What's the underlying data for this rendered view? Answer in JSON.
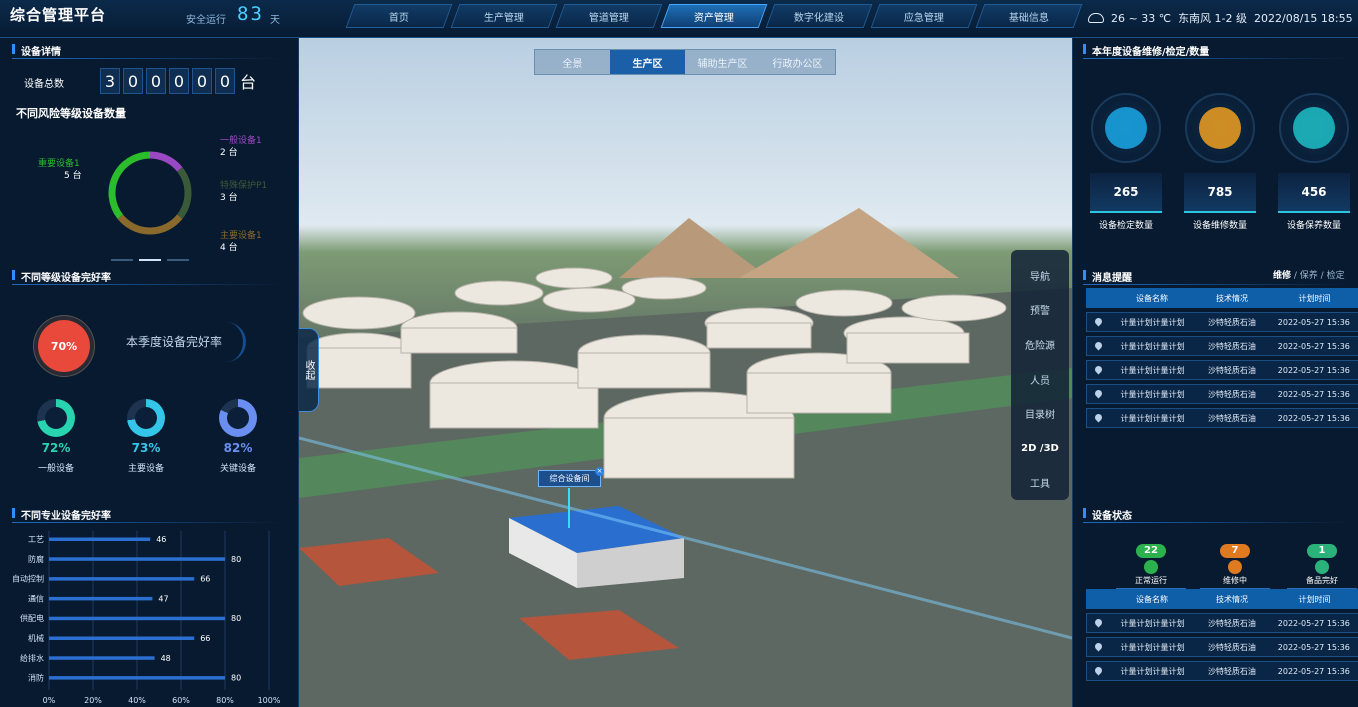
{
  "header": {
    "brand": "综合管理平台",
    "safe_label": "安全运行",
    "safe_days": "83",
    "days_unit": "天",
    "nav": [
      "首页",
      "生产管理",
      "管道管理",
      "资产管理",
      "数字化建设",
      "应急管理",
      "基础信息"
    ],
    "active_nav": "资产管理",
    "weather": {
      "temp": "26 ~ 33 ℃",
      "wind": "东南风 1-2 级",
      "datetime": "2022/08/15 18:55"
    }
  },
  "left": {
    "section1_title": "设备详情",
    "total_label": "设备总数",
    "total_digits": [
      "3",
      "0",
      "0",
      "0",
      "0",
      "0"
    ],
    "total_unit": "台",
    "risk_title": "不同风险等级设备数量",
    "risk_items": [
      {
        "name": "一般设备1",
        "count": "2 台",
        "value": 2,
        "color": "#9b49c2"
      },
      {
        "name": "特殊保护P1",
        "count": "3 台",
        "value": 3,
        "color": "#3b5a3a"
      },
      {
        "name": "主要设备1",
        "count": "4 台",
        "value": 4,
        "color": "#8a6a2c"
      },
      {
        "name": "重要设备1",
        "count": "5 台",
        "value": 5,
        "color": "#2bbd2b"
      }
    ],
    "section2_title": "不同等级设备完好率",
    "quarter_rate": "70%",
    "quarter_label": "本季度设备完好率",
    "rates": [
      {
        "value": "72%",
        "pct": 72,
        "label": "一般设备",
        "color": "#28d3b0"
      },
      {
        "value": "73%",
        "pct": 73,
        "label": "主要设备",
        "color": "#34c6e8"
      },
      {
        "value": "82%",
        "pct": 82,
        "label": "关键设备",
        "color": "#6b8ff0"
      }
    ],
    "section3_title": "不同专业设备完好率"
  },
  "chart_data": {
    "type": "bar",
    "title": "不同专业设备完好率",
    "categories": [
      "工艺",
      "防腐",
      "自动控制",
      "通信",
      "供配电",
      "机械",
      "给排水",
      "消防"
    ],
    "values": [
      46,
      80,
      66,
      47,
      80,
      66,
      48,
      80
    ],
    "xlim": [
      0,
      100
    ],
    "xticks": [
      "0%",
      "20%",
      "40%",
      "60%",
      "80%",
      "100%"
    ],
    "grid": true
  },
  "scene": {
    "zone_tabs": [
      "全景",
      "生产区",
      "辅助生产区",
      "行政办公区"
    ],
    "active_zone": "生产区",
    "collapse_label": "收起",
    "tools": [
      "导航",
      "预警",
      "危险源",
      "人员",
      "目录树",
      "2D /3D",
      "工具"
    ],
    "tag_label": "综合设备间",
    "tag_close": "×"
  },
  "right": {
    "section1_title": "本年度设备维修/检定/数量",
    "stats": [
      {
        "value": "265",
        "label": "设备检定数量",
        "icon": "shield-search-icon",
        "color": "#1aa8e8"
      },
      {
        "value": "785",
        "label": "设备维修数量",
        "icon": "wrench-icon",
        "color": "#f0a020"
      },
      {
        "value": "456",
        "label": "设备保养数量",
        "icon": "oil-can-icon",
        "color": "#20c0c8"
      }
    ],
    "msg_title": "消息提醒",
    "msg_tabs": [
      "维修",
      "保养",
      "检定"
    ],
    "table_headers": [
      "设备名称",
      "技术情况",
      "计划时间"
    ],
    "messages": [
      [
        "计量计划计量计划",
        "沙特轻质石油",
        "2022-05-27 15:36"
      ],
      [
        "计量计划计量计划",
        "沙特轻质石油",
        "2022-05-27 15:36"
      ],
      [
        "计量计划计量计划",
        "沙特轻质石油",
        "2022-05-27 15:36"
      ],
      [
        "计量计划计量计划",
        "沙特轻质石油",
        "2022-05-27 15:36"
      ],
      [
        "计量计划计量计划",
        "沙特轻质石油",
        "2022-05-27 15:36"
      ]
    ],
    "status_title": "设备状态",
    "status": [
      {
        "count": "22",
        "label": "正常运行",
        "color": "#2bb24c"
      },
      {
        "count": "7",
        "label": "维修中",
        "color": "#e07a20"
      },
      {
        "count": "1",
        "label": "备品完好",
        "color": "#2bb27a"
      }
    ],
    "status_rows": [
      [
        "计量计划计量计划",
        "沙特轻质石油",
        "2022-05-27 15:36"
      ],
      [
        "计量计划计量计划",
        "沙特轻质石油",
        "2022-05-27 15:36"
      ],
      [
        "计量计划计量计划",
        "沙特轻质石油",
        "2022-05-27 15:36"
      ]
    ]
  }
}
